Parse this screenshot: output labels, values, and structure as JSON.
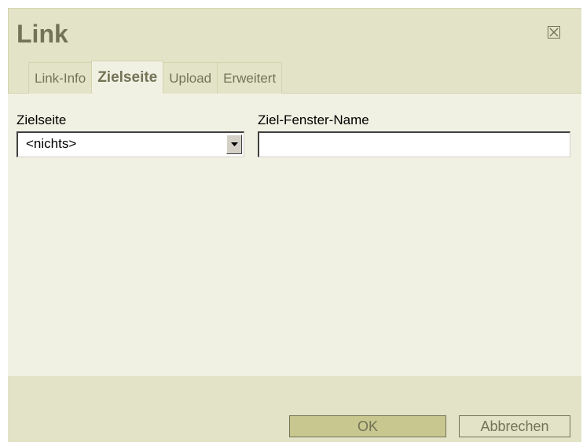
{
  "dialog": {
    "title": "Link",
    "close_icon": "close-icon"
  },
  "tabs": [
    {
      "label": "Link-Info",
      "active": false
    },
    {
      "label": "Zielseite",
      "active": true
    },
    {
      "label": "Upload",
      "active": false
    },
    {
      "label": "Erweitert",
      "active": false
    }
  ],
  "form": {
    "target_label": "Zielseite",
    "target_value": "<nichts>",
    "window_name_label": "Ziel-Fenster-Name",
    "window_name_value": ""
  },
  "buttons": {
    "ok_label": "OK",
    "cancel_label": "Abbrechen"
  },
  "colors": {
    "dialog_bg": "#e3e3c7",
    "panel_bg": "#f1f1e3",
    "accent_text": "#737357",
    "ok_button_bg": "#c7c78f"
  }
}
